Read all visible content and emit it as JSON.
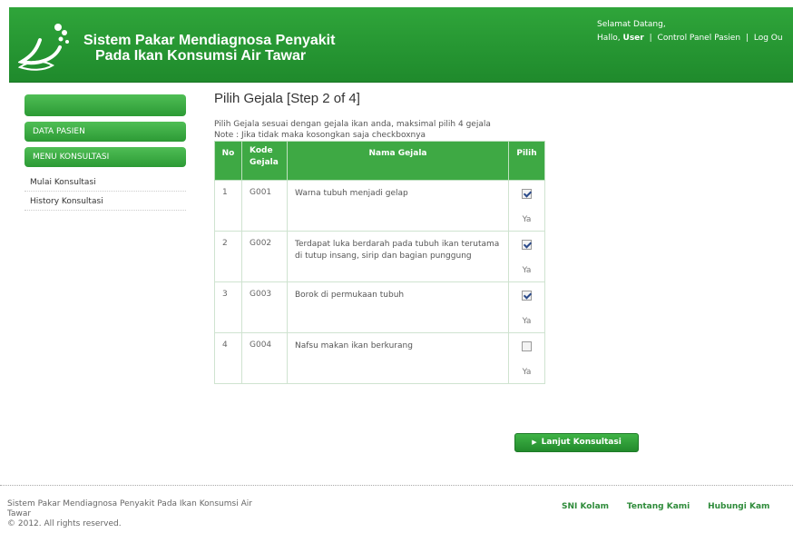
{
  "header": {
    "title_line1": "Sistem Pakar Mendiagnosa Penyakit",
    "title_line2": "Pada Ikan Konsumsi Air Tawar",
    "welcome": "Selamat Datang,",
    "hello_prefix": "Hallo, ",
    "user": "User",
    "sep": "|",
    "control_panel": "Control Panel Pasien",
    "logout": "Log Ou"
  },
  "sidebar": {
    "data_pasien": "DATA PASIEN",
    "menu_konsultasi": "MENU KONSULTASI",
    "items": [
      {
        "label": "Mulai Konsultasi"
      },
      {
        "label": "History Konsultasi"
      }
    ]
  },
  "main": {
    "heading": "Pilih Gejala [Step 2 of 4]",
    "instruction": "Pilih Gejala sesuai dengan gejala ikan anda, maksimal pilih 4 gejala",
    "note": "Note : Jika tidak maka kosongkan saja checkboxnya",
    "table": {
      "headers": {
        "no": "No",
        "kode_line1": "Kode",
        "kode_line2": "Gejala",
        "nama": "Nama Gejala",
        "pilih": "Pilih"
      },
      "rows": [
        {
          "no": "1",
          "kode": "G001",
          "nama": "Warna tubuh menjadi gelap",
          "checked": true,
          "ya": "Ya"
        },
        {
          "no": "2",
          "kode": "G002",
          "nama": "Terdapat luka berdarah pada tubuh ikan terutama di tutup insang, sirip dan bagian punggung",
          "checked": true,
          "ya": "Ya"
        },
        {
          "no": "3",
          "kode": "G003",
          "nama": "Borok di permukaan tubuh",
          "checked": true,
          "ya": "Ya"
        },
        {
          "no": "4",
          "kode": "G004",
          "nama": "Nafsu makan ikan berkurang",
          "checked": false,
          "ya": "Ya"
        }
      ]
    },
    "next_button": "Lanjut Konsultasi"
  },
  "footer": {
    "line1": "Sistem Pakar Mendiagnosa Penyakit Pada Ikan Konsumsi Air",
    "line2": "Tawar",
    "copyright": "© 2012. All rights reserved.",
    "links": [
      "SNI Kolam",
      "Tentang Kami",
      "Hubungi Kam"
    ]
  },
  "colors": {
    "brand_green": "#2fa53a",
    "link_green": "#2e8b3a"
  },
  "icons": {
    "logo": "fish-logo-icon",
    "button_arrow": "triangle-right-icon",
    "checkbox": "checkbox-icon"
  }
}
